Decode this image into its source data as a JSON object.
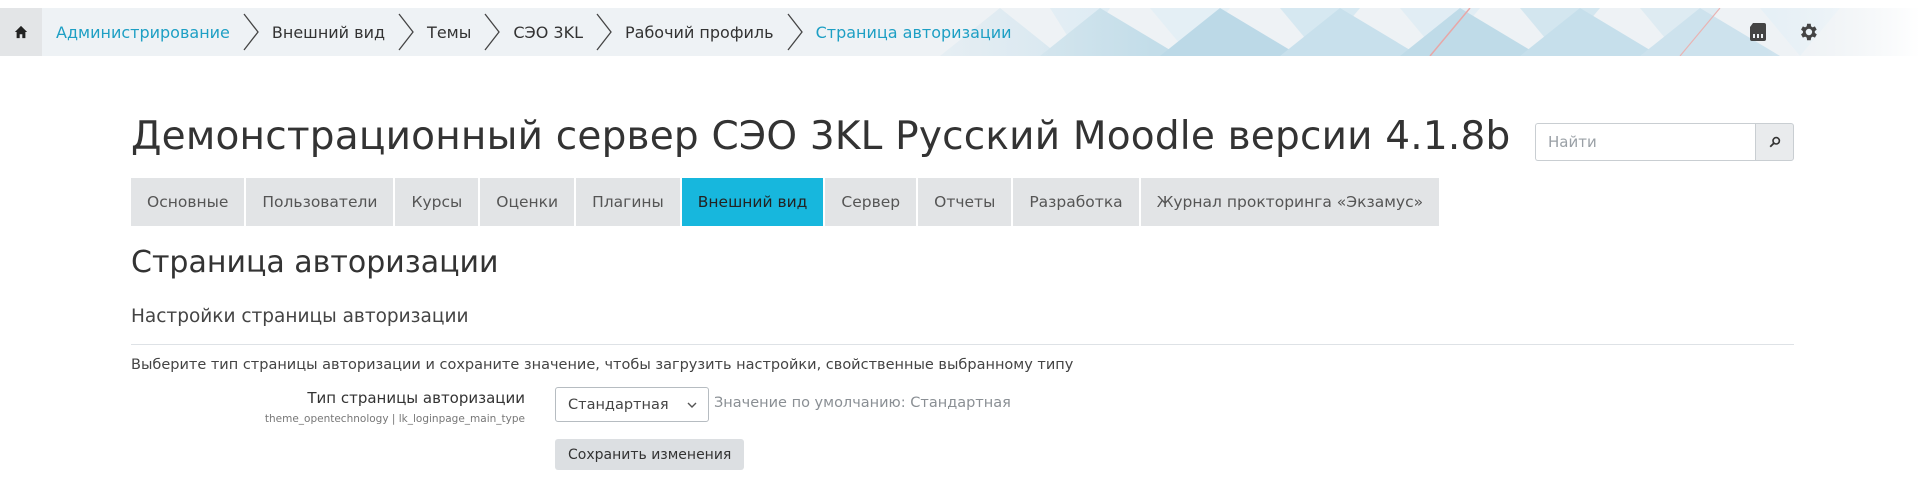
{
  "breadcrumb": {
    "items": [
      {
        "label": "Администрирование",
        "link": true
      },
      {
        "label": "Внешний вид",
        "link": false
      },
      {
        "label": "Темы",
        "link": false
      },
      {
        "label": "СЭО 3KL",
        "link": false
      },
      {
        "label": "Рабочий профиль",
        "link": false
      },
      {
        "label": "Страница авторизации",
        "link": true
      }
    ],
    "home_icon": "home-icon"
  },
  "nav_actions": {
    "icons": [
      "sd-card-icon",
      "gear-icon"
    ]
  },
  "header": {
    "site_title": "Демонстрационный сервер СЭО 3KL Русский Moodle версии 4.1.8b",
    "search_placeholder": "Найти"
  },
  "tabs": {
    "items": [
      {
        "label": "Основные",
        "active": false
      },
      {
        "label": "Пользователи",
        "active": false
      },
      {
        "label": "Курсы",
        "active": false
      },
      {
        "label": "Оценки",
        "active": false
      },
      {
        "label": "Плагины",
        "active": false
      },
      {
        "label": "Внешний вид",
        "active": true
      },
      {
        "label": "Сервер",
        "active": false
      },
      {
        "label": "Отчеты",
        "active": false
      },
      {
        "label": "Разработка",
        "active": false
      },
      {
        "label": "Журнал прокторинга «Экзамус»",
        "active": false
      }
    ]
  },
  "page": {
    "heading": "Страница авторизации",
    "section_heading": "Настройки страницы авторизации",
    "description": "Выберите тип страницы авторизации и сохраните значение, чтобы загрузить настройки, свойственные выбранному типу",
    "setting": {
      "label": "Тип страницы авторизации",
      "key": "theme_opentechnology | lk_loginpage_main_type",
      "selected": "Стандартная",
      "default_text": "Значение по умолчанию: Стандартная"
    },
    "save_label": "Сохранить изменения"
  },
  "colors": {
    "accent": "#17b7dd",
    "link": "#1d9fc4",
    "tab_bg": "#e2e4e6"
  }
}
